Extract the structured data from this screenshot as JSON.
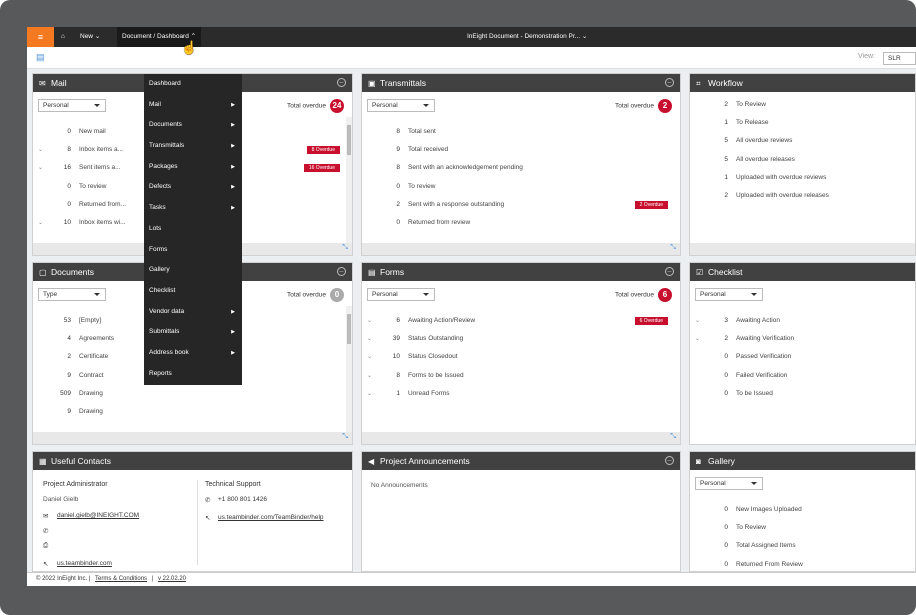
{
  "topbar": {
    "new": "New",
    "crumb": "Document / Dashboard",
    "title": "InEight Document - Demonstration Pr..."
  },
  "view": {
    "label": "View:",
    "value": "SLR"
  },
  "menu": [
    {
      "label": "Dashboard",
      "sub": false
    },
    {
      "label": "Mail",
      "sub": true
    },
    {
      "label": "Documents",
      "sub": true
    },
    {
      "label": "Transmittals",
      "sub": true
    },
    {
      "label": "Packages",
      "sub": true
    },
    {
      "label": "Defects",
      "sub": true
    },
    {
      "label": "Tasks",
      "sub": true
    },
    {
      "label": "Lots",
      "sub": false
    },
    {
      "label": "Forms",
      "sub": false
    },
    {
      "label": "Gallery",
      "sub": false
    },
    {
      "label": "Checklist",
      "sub": false
    },
    {
      "label": "Vendor data",
      "sub": true
    },
    {
      "label": "Submittals",
      "sub": true
    },
    {
      "label": "Address book",
      "sub": true
    },
    {
      "label": "Reports",
      "sub": false
    }
  ],
  "panels": {
    "mail": {
      "title": "Mail",
      "select": "Personal",
      "overdue_label": "Total overdue",
      "overdue": "24",
      "rows": [
        {
          "n": "0",
          "l": "New mail",
          "c": false,
          "b": ""
        },
        {
          "n": "8",
          "l": "Inbox items a...",
          "c": true,
          "b": "8 Overdue"
        },
        {
          "n": "16",
          "l": "Sent items a...",
          "c": true,
          "b": "16 Overdue"
        },
        {
          "n": "0",
          "l": "To review",
          "c": false,
          "b": ""
        },
        {
          "n": "0",
          "l": "Returned from...",
          "c": false,
          "b": ""
        },
        {
          "n": "10",
          "l": "Inbox items wi...",
          "c": true,
          "b": ""
        }
      ]
    },
    "transmittals": {
      "title": "Transmittals",
      "select": "Personal",
      "overdue_label": "Total overdue",
      "overdue": "2",
      "rows": [
        {
          "n": "8",
          "l": "Total sent",
          "c": false,
          "b": ""
        },
        {
          "n": "9",
          "l": "Total received",
          "c": false,
          "b": ""
        },
        {
          "n": "8",
          "l": "Sent with an acknowledgement pending",
          "c": false,
          "b": ""
        },
        {
          "n": "0",
          "l": "To review",
          "c": false,
          "b": ""
        },
        {
          "n": "2",
          "l": "Sent with a response outstanding",
          "c": false,
          "b": "2 Overdue"
        },
        {
          "n": "0",
          "l": "Returned from review",
          "c": false,
          "b": ""
        }
      ]
    },
    "workflow": {
      "title": "Workflow",
      "rows": [
        {
          "n": "2",
          "l": "To Review",
          "c": false,
          "b": ""
        },
        {
          "n": "1",
          "l": "To Release",
          "c": false,
          "b": ""
        },
        {
          "n": "5",
          "l": "All overdue reviews",
          "c": false,
          "b": ""
        },
        {
          "n": "5",
          "l": "All overdue releases",
          "c": false,
          "b": ""
        },
        {
          "n": "1",
          "l": "Uploaded with overdue reviews",
          "c": false,
          "b": ""
        },
        {
          "n": "2",
          "l": "Uploaded with overdue releases",
          "c": false,
          "b": ""
        }
      ]
    },
    "documents": {
      "title": "Documents",
      "select": "Type",
      "overdue_label": "Total overdue",
      "overdue": "0",
      "rows": [
        {
          "n": "53",
          "l": "[Empty]",
          "c": false,
          "b": ""
        },
        {
          "n": "4",
          "l": "Agreements",
          "c": false,
          "b": ""
        },
        {
          "n": "2",
          "l": "Certificate",
          "c": false,
          "b": ""
        },
        {
          "n": "9",
          "l": "Contract",
          "c": false,
          "b": ""
        },
        {
          "n": "509",
          "l": "Drawing",
          "c": false,
          "b": ""
        },
        {
          "n": "9",
          "l": "Drawing",
          "c": false,
          "b": ""
        }
      ]
    },
    "forms": {
      "title": "Forms",
      "select": "Personal",
      "overdue_label": "Total overdue",
      "overdue": "6",
      "rows": [
        {
          "n": "6",
          "l": "Awaiting Action/Review",
          "c": true,
          "b": "6 Overdue"
        },
        {
          "n": "39",
          "l": "Status Outstanding",
          "c": true,
          "b": ""
        },
        {
          "n": "10",
          "l": "Status Closedout",
          "c": true,
          "b": ""
        },
        {
          "n": "8",
          "l": "Forms to be Issued",
          "c": true,
          "b": ""
        },
        {
          "n": "1",
          "l": "Unread Forms",
          "c": true,
          "b": ""
        }
      ]
    },
    "checklist": {
      "title": "Checklist",
      "select": "Personal",
      "rows": [
        {
          "n": "3",
          "l": "Awaiting Action",
          "c": true,
          "b": ""
        },
        {
          "n": "2",
          "l": "Awaiting Verification",
          "c": true,
          "b": ""
        },
        {
          "n": "0",
          "l": "Passed Verification",
          "c": false,
          "b": ""
        },
        {
          "n": "0",
          "l": "Failed Verification",
          "c": false,
          "b": ""
        },
        {
          "n": "0",
          "l": "To be Issued",
          "c": false,
          "b": ""
        }
      ]
    },
    "contacts": {
      "title": "Useful Contacts",
      "admin_title": "Project Administrator",
      "admin_name": "Daniel Gielb",
      "admin_email": "daniel.gielb@INEIGHT.COM",
      "admin_link": "us.teambinder.com",
      "support_title": "Technical Support",
      "support_phone": "+1 800 801 1426",
      "support_link": "us.teambinder.com/TeamBinder/help"
    },
    "announcements": {
      "title": "Project Announcements",
      "text": "No Announcements"
    },
    "gallery": {
      "title": "Gallery",
      "select": "Personal",
      "rows": [
        {
          "n": "0",
          "l": "New Images Uploaded",
          "c": false,
          "b": ""
        },
        {
          "n": "0",
          "l": "To Review",
          "c": false,
          "b": ""
        },
        {
          "n": "0",
          "l": "Total Assigned Items",
          "c": false,
          "b": ""
        },
        {
          "n": "0",
          "l": "Returned From Review",
          "c": false,
          "b": ""
        }
      ]
    }
  },
  "footer": {
    "copy": "© 2022 InEight Inc.",
    "terms": "Terms & Conditions",
    "version": "v 22.02.20"
  }
}
